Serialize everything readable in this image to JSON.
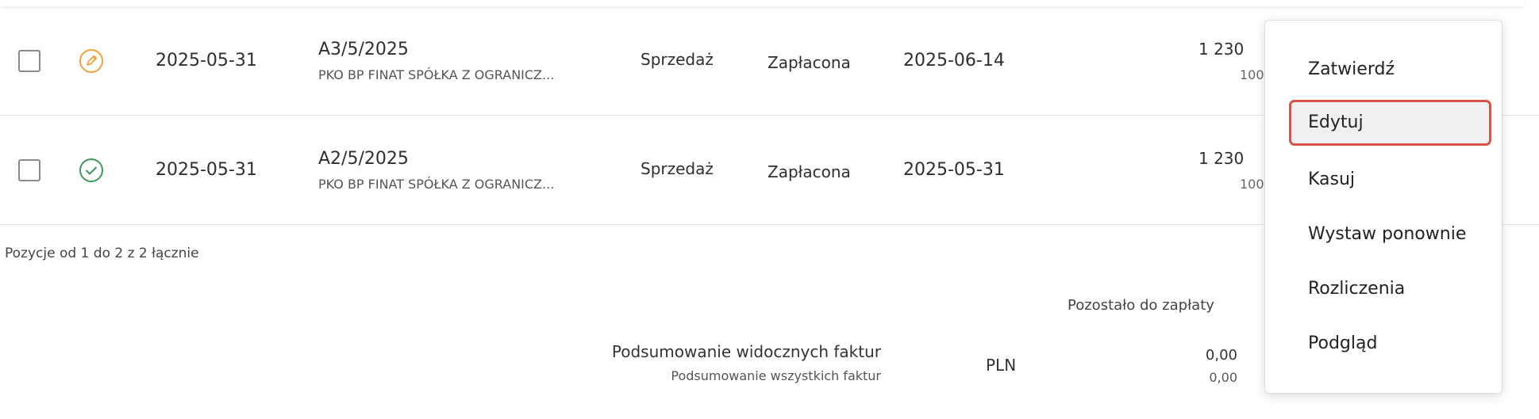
{
  "rows": [
    {
      "status_icon": "edit-pencil-icon",
      "status_color": "#f0a338",
      "date": "2025-05-31",
      "number": "A3/5/2025",
      "client": "PKO BP FINAT SPÓŁKA Z OGRANICZ...",
      "type": "Sprzedaż",
      "payment_status": "Zapłacona",
      "due_date": "2025-06-14",
      "amount": "1 230",
      "amount_sub": "100"
    },
    {
      "status_icon": "check-circle-icon",
      "status_color": "#3a9a5c",
      "date": "2025-05-31",
      "number": "A2/5/2025",
      "client": "PKO BP FINAT SPÓŁKA Z OGRANICZ...",
      "type": "Sprzedaż",
      "payment_status": "Zapłacona",
      "due_date": "2025-05-31",
      "amount": "1 230",
      "amount_sub": "100"
    }
  ],
  "pagination": {
    "text": "Pozycje od 1 do 2 z 2 łącznie"
  },
  "summary": {
    "remaining_header": "Pozostało do zapłaty",
    "visible_label": "Podsumowanie widocznych faktur",
    "all_label": "Podsumowanie wszystkich faktur",
    "currency": "PLN",
    "visible_value": "0,00",
    "all_value": "0,00"
  },
  "context_menu": {
    "items": [
      "Zatwierdź",
      "Edytuj",
      "Kasuj",
      "Wystaw ponownie",
      "Rozliczenia",
      "Podgląd"
    ],
    "active": "Edytuj",
    "highlight_color": "#d6524a"
  }
}
